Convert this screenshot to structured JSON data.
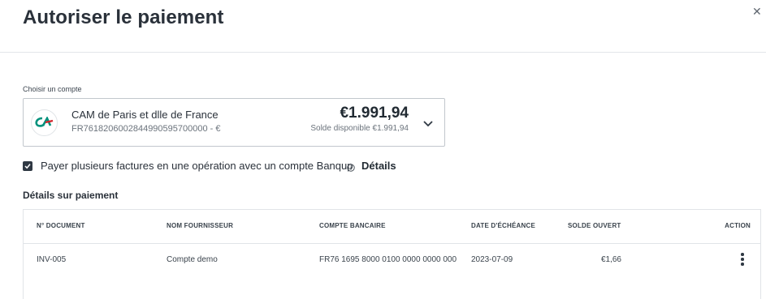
{
  "dialog": {
    "title": "Autoriser le paiement",
    "close_icon": "close-icon"
  },
  "account": {
    "label": "Choisir un compte",
    "bank_logo": "credit-agricole-logo",
    "name": "CAM de Paris et dlle de France",
    "iban": "FR7618206002844990595700000 - €",
    "balance": "€1.991,94",
    "available": "Solde disponible €1.991,94"
  },
  "options": {
    "multi_pay_checked": true,
    "multi_pay_label": "Payer plusieurs factures en une opération avec un compte Banqup",
    "details_link": "Détails"
  },
  "payment_details": {
    "title": "Détails sur paiement",
    "columns": [
      "N° DOCUMENT",
      "NOM FOURNISSEUR",
      "COMPTE BANCAIRE",
      "DATE D'ÉCHÉANCE",
      "SOLDE OUVERT",
      "ACTION"
    ],
    "rows": [
      {
        "document": "INV-005",
        "supplier": "Compte demo",
        "bank_account": "FR76 1695 8000 0100 0000 0000 000",
        "due_date": "2023-07-09",
        "open_balance": "€1,66"
      }
    ]
  },
  "colors": {
    "text": "#2a313a",
    "muted": "#6b737c",
    "border": "#c2c7cd",
    "brand_green": "#00917c",
    "brand_red": "#d1242b"
  }
}
